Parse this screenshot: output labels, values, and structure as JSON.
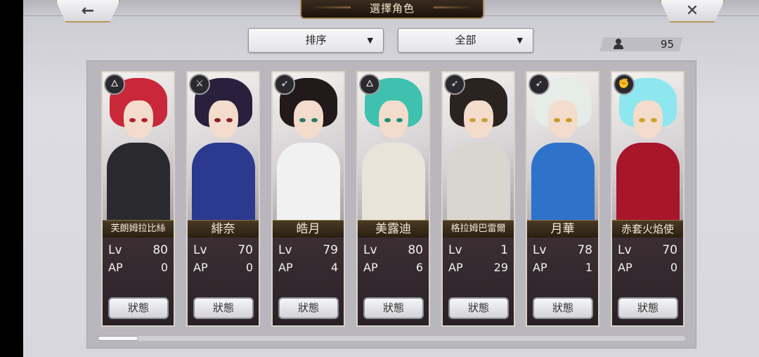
{
  "header": {
    "title": "選擇角色",
    "back_icon": "←",
    "close_icon": "✕"
  },
  "controls": {
    "sort_label": "排序",
    "filter_label": "全部",
    "caret": "▼",
    "character_count": "95"
  },
  "status_label": "狀態",
  "characters": [
    {
      "name": "芙朗姆拉比絲",
      "lv_label": "Lv",
      "lv": "80",
      "ap_label": "AP",
      "ap": "0",
      "class_icon": "🜂",
      "hair": "#c8283a",
      "outfit": "#2a2a2e",
      "eye": "#b02030"
    },
    {
      "name": "緋奈",
      "lv_label": "Lv",
      "lv": "70",
      "ap_label": "AP",
      "ap": "0",
      "class_icon": "⚔",
      "hair": "#2a1f3d",
      "outfit": "#2b3a8f",
      "eye": "#8a1f2a"
    },
    {
      "name": "皓月",
      "lv_label": "Lv",
      "lv": "79",
      "ap_label": "AP",
      "ap": "4",
      "class_icon": "➶",
      "hair": "#221a1a",
      "outfit": "#f1f1f1",
      "eye": "#2c7a6e"
    },
    {
      "name": "美露迪",
      "lv_label": "Lv",
      "lv": "80",
      "ap_label": "AP",
      "ap": "6",
      "class_icon": "🜂",
      "hair": "#3fc1b0",
      "outfit": "#e8e4da",
      "eye": "#1f8f7a"
    },
    {
      "name": "格拉姆巴雷爾",
      "lv_label": "Lv",
      "lv": "1",
      "ap_label": "AP",
      "ap": "29",
      "class_icon": "➶",
      "hair": "#2a2320",
      "outfit": "#d9d6d0",
      "eye": "#c8a23a"
    },
    {
      "name": "月華",
      "lv_label": "Lv",
      "lv": "78",
      "ap_label": "AP",
      "ap": "1",
      "class_icon": "➶",
      "hair": "#e6ece8",
      "outfit": "#2f72c9",
      "eye": "#c99a2a"
    },
    {
      "name": "赤套火焰使",
      "lv_label": "Lv",
      "lv": "70",
      "ap_label": "AP",
      "ap": "0",
      "class_icon": "✊",
      "hair": "#8ee6ef",
      "outfit": "#a8162a",
      "eye": "#c9a12a"
    }
  ]
}
